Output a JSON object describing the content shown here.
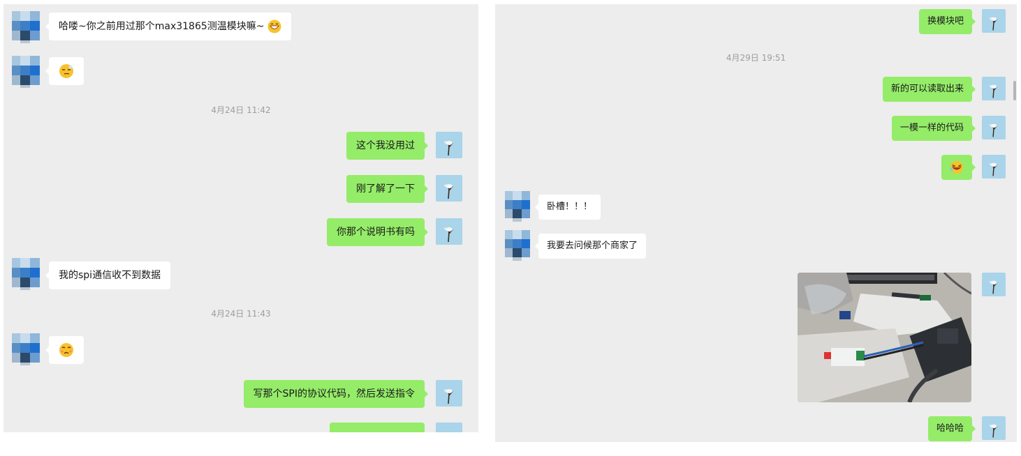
{
  "left": {
    "messages": [
      {
        "text": "哈喽~你之前用过那个max31865测温模块嘛~"
      },
      {
        "text": "这个我没用过"
      },
      {
        "text": "刚了解了一下"
      },
      {
        "text": "你那个说明书有吗"
      },
      {
        "text": "我的spi通信收不到数据"
      },
      {
        "text": "写那个SPI的协议代码，然后发送指令"
      }
    ],
    "timestamps": [
      "4月24日 11:42",
      "4月24日 11:43"
    ]
  },
  "right": {
    "messages": [
      {
        "text": "换模块吧"
      },
      {
        "text": "新的可以读取出来"
      },
      {
        "text": "一模一样的代码"
      },
      {
        "text": "卧槽！！！"
      },
      {
        "text": "我要去问候那个商家了"
      },
      {
        "text": "哈哈哈"
      }
    ],
    "timestamps": [
      "4月29日 19:51"
    ]
  },
  "icons": {
    "grin": "grinning-emoji-icon",
    "smirk": "smirk-emoji-icon",
    "sad": "sad-emoji-icon",
    "laugh": "laughing-emoji-icon",
    "photo": "hardware-photo"
  },
  "colors": {
    "outgoing_bubble": "#95ec69",
    "incoming_bubble": "#ffffff",
    "chat_background": "#ededed",
    "own_avatar": "#a9d4ea"
  }
}
